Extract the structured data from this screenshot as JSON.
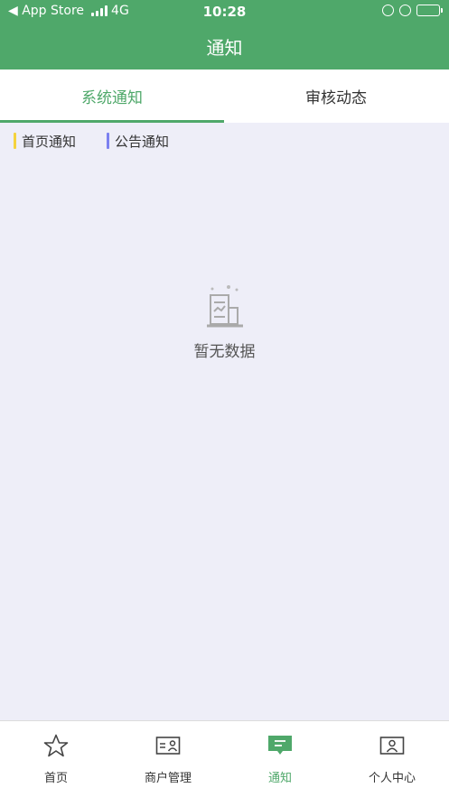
{
  "status_bar": {
    "back_label": "◀ App Store",
    "network": "4G",
    "time": "10:28"
  },
  "header": {
    "title": "通知"
  },
  "tabs": [
    {
      "label": "系统通知",
      "active": true
    },
    {
      "label": "审核动态",
      "active": false
    }
  ],
  "filters": [
    {
      "label": "首页通知",
      "color": "#f5d33d"
    },
    {
      "label": "公告通知",
      "color": "#7b80f0"
    }
  ],
  "empty_state": {
    "text": "暂无数据"
  },
  "bottom_nav": [
    {
      "label": "首页",
      "icon": "star-icon",
      "active": false
    },
    {
      "label": "商户管理",
      "icon": "merchant-card-icon",
      "active": false
    },
    {
      "label": "通知",
      "icon": "message-icon",
      "active": true
    },
    {
      "label": "个人中心",
      "icon": "profile-card-icon",
      "active": false
    }
  ],
  "colors": {
    "primary": "#4fa86a",
    "background": "#eeeef8"
  }
}
